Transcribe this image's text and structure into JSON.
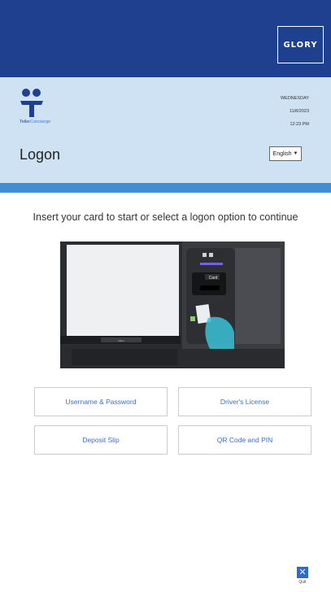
{
  "brand": {
    "name": "GLORY",
    "logo_text_a": "Teller",
    "logo_text_b": "Concierge"
  },
  "datetime": {
    "day": "WEDNESDAY",
    "date": "11/8/2023",
    "time": "12:23 PM"
  },
  "page": {
    "title": "Logon"
  },
  "language": {
    "selected": "English"
  },
  "main": {
    "instruction": "Insert your card to start or select a logon option to continue",
    "illustration_labels": {
      "slot": "Card",
      "brand": "Glory"
    }
  },
  "options": {
    "username": "Username & Password",
    "drivers": "Driver's License",
    "deposit": "Deposit Slip",
    "qr": "QR Code and PIN"
  },
  "footer": {
    "quit": "Quit"
  },
  "colors": {
    "top": "#1f3f8f",
    "header": "#cfe2f4",
    "stripe": "#3f8fd6",
    "accent": "#3a6fc6"
  }
}
